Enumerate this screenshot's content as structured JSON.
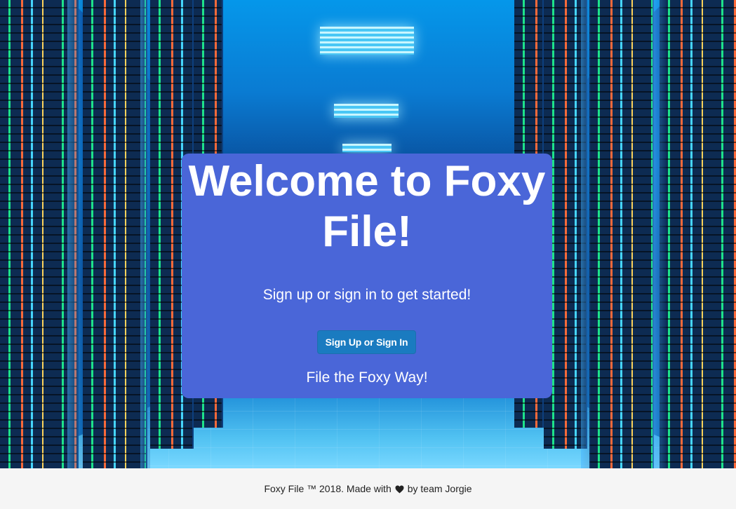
{
  "panel": {
    "title": "Welcome to Foxy File!",
    "subtitle": "Sign up or sign in to get started!",
    "button_label": "Sign Up or Sign In",
    "tagline": "File the Foxy Way!"
  },
  "footer": {
    "text_before": "Foxy File ™ 2018. Made with",
    "icon": "heart-icon",
    "text_after": "by team Jorgie"
  },
  "colors": {
    "panel_bg": "#4a66d8",
    "button_bg": "#1a7bc0",
    "footer_bg": "#f5f5f5"
  }
}
